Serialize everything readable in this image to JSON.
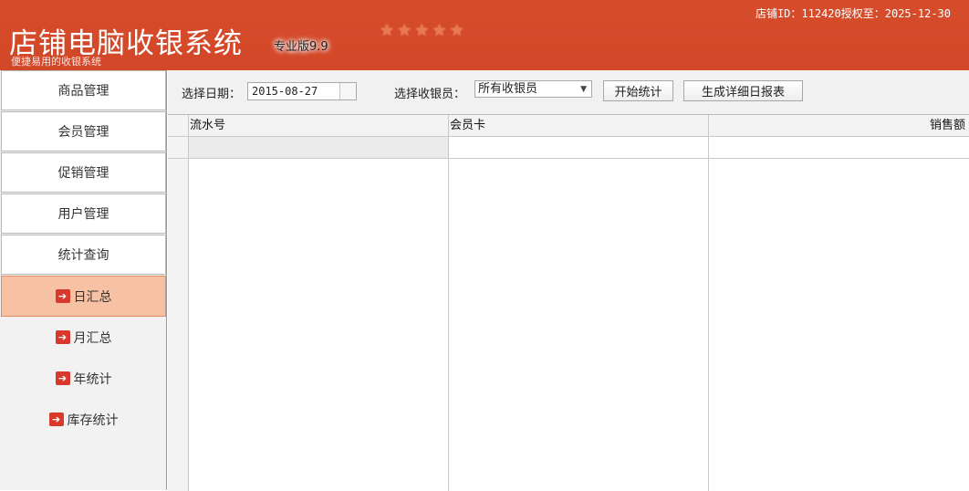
{
  "header": {
    "title": "店铺电脑收银系统",
    "edition": "专业版9.9",
    "subtitle": "便捷易用的收银系统",
    "store_info": "店铺ID：112420授权至：2025-12-30",
    "star_count": 5,
    "colors": {
      "accent": "#d24727",
      "active_bg": "#f7c1a4"
    }
  },
  "sidebar": {
    "items": [
      {
        "label": "商品管理"
      },
      {
        "label": "会员管理"
      },
      {
        "label": "促销管理"
      },
      {
        "label": "用户管理"
      },
      {
        "label": "统计查询"
      }
    ],
    "sub_items": [
      {
        "label": "日汇总",
        "icon": "arrow-right-icon",
        "active": true
      },
      {
        "label": "月汇总",
        "icon": "arrow-right-icon",
        "active": false
      },
      {
        "label": "年统计",
        "icon": "arrow-right-icon",
        "active": false
      },
      {
        "label": "库存统计",
        "icon": "arrow-right-icon",
        "active": false
      }
    ]
  },
  "toolbar": {
    "date_label": "选择日期：",
    "date_value": "2015-08-27",
    "cashier_label": "选择收银员：",
    "cashier_value": "所有收银员",
    "start_button": "开始统计",
    "report_button": "生成详细日报表"
  },
  "grid": {
    "columns": [
      "流水号",
      "会员卡",
      "销售额"
    ],
    "rows": []
  }
}
